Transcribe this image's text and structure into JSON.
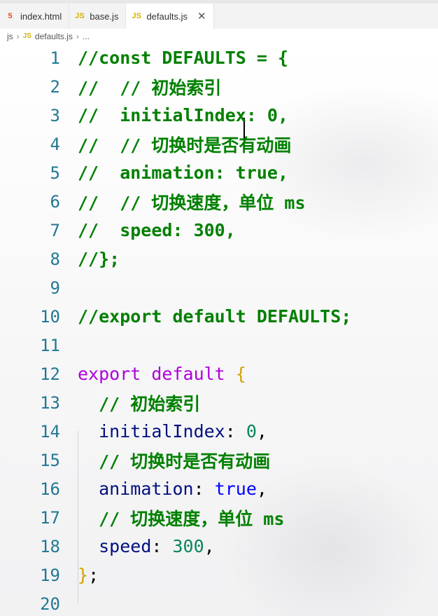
{
  "tabs": [
    {
      "icon": "html5-icon",
      "label": "index.html"
    },
    {
      "icon": "js-icon",
      "label": "base.js"
    },
    {
      "icon": "js-icon",
      "label": "defaults.js",
      "active": true
    }
  ],
  "breadcrumb": {
    "folder": "js",
    "file": "defaults.js",
    "rest": "..."
  },
  "lines": [
    {
      "n": "1",
      "t": "//const DEFAULTS = {"
    },
    {
      "n": "2",
      "t": "//  // 初始索引"
    },
    {
      "n": "3",
      "t": "//  initialIndex: 0,"
    },
    {
      "n": "4",
      "t": "//  // 切换时是否有动画"
    },
    {
      "n": "5",
      "t": "//  animation: true,"
    },
    {
      "n": "6",
      "t": "//  // 切换速度，单位 ms"
    },
    {
      "n": "7",
      "t": "//  speed: 300,"
    },
    {
      "n": "8",
      "t": "//};"
    },
    {
      "n": "9",
      "t": ""
    },
    {
      "n": "10",
      "t": "//export default DEFAULTS;"
    },
    {
      "n": "11",
      "t": ""
    },
    {
      "n": "12",
      "kw": "export default",
      "brace": "{"
    },
    {
      "n": "13",
      "t": "  // 初始索引"
    },
    {
      "n": "14",
      "prop": "initialIndex",
      "val": "0",
      "valtype": "num"
    },
    {
      "n": "15",
      "t": "  // 切换时是否有动画"
    },
    {
      "n": "16",
      "prop": "animation",
      "val": "true",
      "valtype": "bool"
    },
    {
      "n": "17",
      "t": "  // 切换速度，单位 ms"
    },
    {
      "n": "18",
      "prop": "speed",
      "val": "300",
      "valtype": "num"
    },
    {
      "n": "19",
      "close": "}",
      "semi": ";"
    },
    {
      "n": "20",
      "t": ""
    }
  ],
  "colors": {
    "comment": "#008000",
    "keyword": "#af00db",
    "brace": "#d4a000",
    "property": "#001080",
    "number": "#098658",
    "boolean": "#0000ff",
    "line_number": "#237893"
  }
}
